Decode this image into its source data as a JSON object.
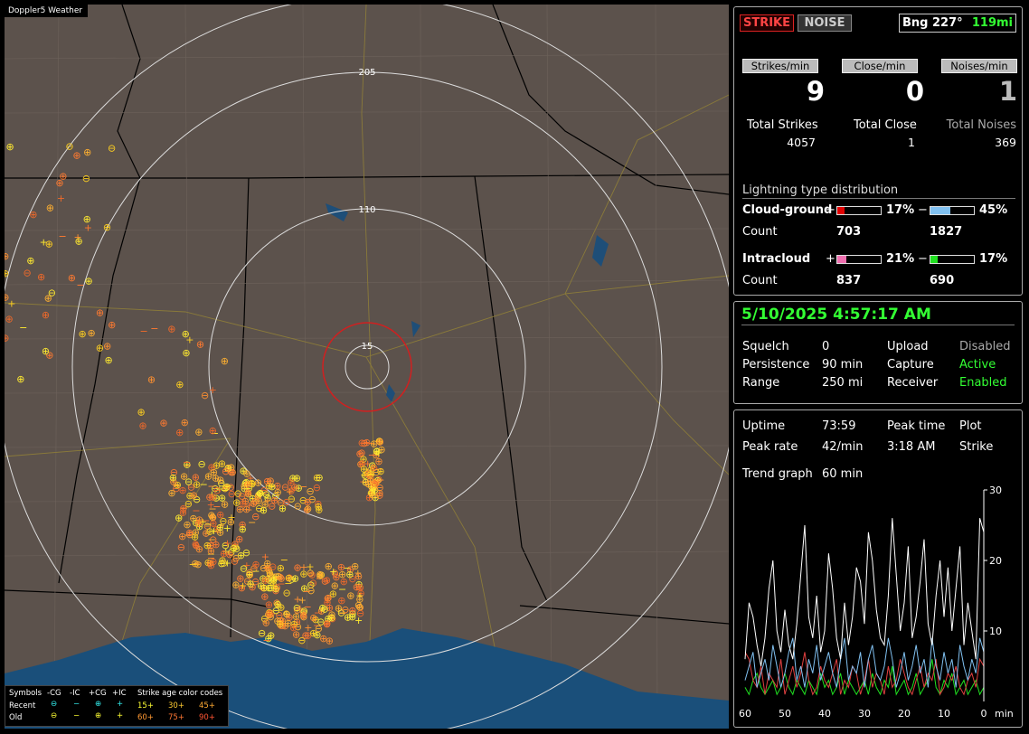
{
  "map": {
    "title": "Doppler5 Weather",
    "rings": [
      "205",
      "110",
      "15"
    ]
  },
  "legend": {
    "symbols_label": "Symbols",
    "col_headers": [
      "-CG",
      "-IC",
      "+CG",
      "+IC"
    ],
    "age_label": "Strike age color codes",
    "recent_label": "Recent",
    "old_label": "Old",
    "recent_ages": [
      "15+",
      "30+",
      "45+"
    ],
    "old_ages": [
      "60+",
      "75+",
      "90+"
    ]
  },
  "status": {
    "strike_button": "STRIKE",
    "noise_button": "NOISE",
    "bearing": "Bng 227°",
    "distance": "119mi"
  },
  "rates": {
    "strikes_label": "Strikes/min",
    "close_label": "Close/min",
    "noises_label": "Noises/min",
    "strikes": "9",
    "close": "0",
    "noises": "1"
  },
  "totals": {
    "strikes_label": "Total Strikes",
    "close_label": "Total Close",
    "noises_label": "Total Noises",
    "strikes": "4057",
    "close": "1",
    "noises": "369"
  },
  "distribution": {
    "title": "Lightning type distribution",
    "cg_label": "Cloud-ground",
    "ic_label": "Intracloud",
    "count_label": "Count",
    "plus": "+",
    "minus": "−",
    "cg_pos_pct": "17%",
    "cg_neg_pct": "45%",
    "ic_pos_pct": "21%",
    "ic_neg_pct": "17%",
    "cg_pos_count": "703",
    "cg_neg_count": "1827",
    "ic_pos_count": "837",
    "ic_neg_count": "690",
    "cg_pos_frac": 0.17,
    "cg_neg_frac": 0.45,
    "ic_pos_frac": 0.21,
    "ic_neg_frac": 0.17,
    "colors": {
      "cg_pos": "#e00000",
      "cg_neg": "#80c0f0",
      "ic_pos": "#f070b0",
      "ic_neg": "#20e020"
    }
  },
  "settings": {
    "timestamp": "5/10/2025 4:57:17 AM",
    "squelch_label": "Squelch",
    "squelch": "0",
    "persistence_label": "Persistence",
    "persistence": "90 min",
    "range_label": "Range",
    "range": "250 mi",
    "upload_label": "Upload",
    "upload": "Disabled",
    "capture_label": "Capture",
    "capture": "Active",
    "receiver_label": "Receiver",
    "receiver": "Enabled"
  },
  "stats": {
    "uptime_label": "Uptime",
    "uptime": "73:59",
    "peak_time_label": "Peak time",
    "peak_time": "3:18 AM",
    "plot_label": "Plot",
    "plot": "Strike",
    "peak_rate_label": "Peak rate",
    "peak_rate": "42/min",
    "trend_label": "Trend graph",
    "trend": "60 min"
  },
  "chart_data": {
    "type": "line",
    "x": [
      60,
      59,
      58,
      57,
      56,
      55,
      54,
      53,
      52,
      51,
      50,
      49,
      48,
      47,
      46,
      45,
      44,
      43,
      42,
      41,
      40,
      39,
      38,
      37,
      36,
      35,
      34,
      33,
      32,
      31,
      30,
      29,
      28,
      27,
      26,
      25,
      24,
      23,
      22,
      21,
      20,
      19,
      18,
      17,
      16,
      15,
      14,
      13,
      12,
      11,
      10,
      9,
      8,
      7,
      6,
      5,
      4,
      3,
      2,
      1,
      0
    ],
    "xlabel": "min",
    "x_ticks": [
      "60",
      "50",
      "40",
      "30",
      "20",
      "10",
      "0"
    ],
    "y_ticks": [
      "10",
      "20",
      "30"
    ],
    "ylim": [
      0,
      30
    ],
    "series": [
      {
        "color": "#ffffff",
        "values": [
          6,
          14,
          12,
          8,
          5,
          9,
          16,
          20,
          10,
          7,
          13,
          8,
          6,
          11,
          18,
          25,
          12,
          9,
          15,
          7,
          10,
          21,
          16,
          9,
          6,
          14,
          8,
          12,
          19,
          17,
          11,
          24,
          20,
          13,
          9,
          8,
          15,
          26,
          18,
          10,
          14,
          22,
          9,
          12,
          17,
          23,
          11,
          8,
          15,
          20,
          12,
          19,
          10,
          16,
          22,
          8,
          14,
          10,
          6,
          26,
          24
        ]
      },
      {
        "color": "#80c0f0",
        "values": [
          3,
          5,
          7,
          2,
          4,
          6,
          3,
          8,
          5,
          2,
          4,
          7,
          9,
          3,
          5,
          2,
          6,
          4,
          8,
          3,
          5,
          7,
          4,
          2,
          6,
          9,
          3,
          5,
          4,
          7,
          2,
          6,
          8,
          4,
          3,
          5,
          9,
          6,
          2,
          4,
          7,
          3,
          5,
          8,
          4,
          6,
          2,
          9,
          5,
          3,
          7,
          4,
          6,
          2,
          8,
          5,
          3,
          6,
          4,
          9,
          7
        ]
      },
      {
        "color": "#e04040",
        "values": [
          7,
          6,
          3,
          2,
          5,
          1,
          4,
          3,
          2,
          6,
          1,
          3,
          5,
          2,
          4,
          7,
          3,
          1,
          2,
          5,
          3,
          2,
          4,
          6,
          1,
          3,
          2,
          5,
          4,
          1,
          3,
          6,
          2,
          4,
          3,
          1,
          5,
          2,
          3,
          6,
          4,
          2,
          1,
          3,
          5,
          2,
          4,
          3,
          6,
          1,
          2,
          4,
          3,
          5,
          2,
          1,
          3,
          4,
          2,
          6,
          5
        ]
      },
      {
        "color": "#20e020",
        "values": [
          2,
          1,
          3,
          4,
          2,
          1,
          2,
          3,
          1,
          2,
          4,
          2,
          1,
          3,
          2,
          1,
          3,
          2,
          1,
          4,
          2,
          3,
          1,
          2,
          4,
          1,
          3,
          2,
          1,
          2,
          3,
          1,
          4,
          2,
          1,
          3,
          2,
          5,
          1,
          2,
          3,
          1,
          2,
          4,
          1,
          2,
          3,
          6,
          2,
          1,
          3,
          2,
          4,
          1,
          2,
          3,
          1,
          2,
          3,
          1,
          2
        ]
      }
    ]
  }
}
